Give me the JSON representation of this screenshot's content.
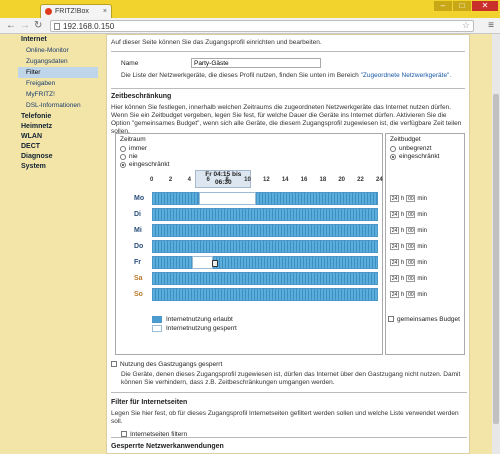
{
  "browser": {
    "tab_title": "FRITZ!Box",
    "url": "192.168.0.150",
    "window_buttons": [
      "–",
      "□",
      "✕"
    ]
  },
  "sidebar": {
    "section": "Internet",
    "sub_items": [
      {
        "label": "Online-Monitor"
      },
      {
        "label": "Zugangsdaten"
      },
      {
        "label": "Filter",
        "active": true
      },
      {
        "label": "Freigaben"
      },
      {
        "label": "MyFRITZ!"
      },
      {
        "label": "DSL-Informationen"
      }
    ],
    "main_items": [
      "Telefonie",
      "Heimnetz",
      "WLAN",
      "DECT",
      "Diagnose",
      "System"
    ]
  },
  "content": {
    "intro": "Auf dieser Seite können Sie das Zugangsprofil einrichten und bearbeiten.",
    "name_label": "Name",
    "name_value": "Party-Gäste",
    "devices_text": "Die Liste der Netzwerkgeräte, die dieses Profil nutzen, finden Sie unten im Bereich",
    "devices_link": "\"Zugeordnete Netzwerkgeräte\".",
    "time_heading": "Zeitbeschränkung",
    "time_text": "Hier können Sie festlegen, innerhalb welchen Zeitraums die zugeordneten Netzwerkgeräte das Internet nutzen dürfen. Wenn Sie ein Zeitbudget vergeben, legen Sie fest, für welche Dauer die Geräte ins Internet dürfen. Aktivieren Sie die Option \"gemeinsames Budget\", wenn sich alle Geräte, die diesem Zugangsprofil zugewiesen ist, die verfügbare Zeit teilen sollen.",
    "zeitraum": {
      "title": "Zeitraum",
      "options": [
        {
          "label": "immer",
          "selected": false
        },
        {
          "label": "nie",
          "selected": false
        },
        {
          "label": "eingeschränkt",
          "selected": true
        }
      ]
    },
    "zeitbudget": {
      "title": "Zeitbudget",
      "options": [
        {
          "label": "unbegrenzt",
          "selected": false
        },
        {
          "label": "eingeschränkt",
          "selected": true
        }
      ],
      "shared_label": "gemeinsames Budget"
    },
    "tooltip": "Fr 04:15 bis 06:30",
    "hours": [
      "0",
      "2",
      "4",
      "6",
      "8",
      "10",
      "12",
      "14",
      "16",
      "18",
      "20",
      "22",
      "24"
    ],
    "days": [
      {
        "label": "Mo",
        "weekend": false,
        "gap": [
          5,
          11
        ]
      },
      {
        "label": "Di",
        "weekend": false,
        "gap": null
      },
      {
        "label": "Mi",
        "weekend": false,
        "gap": null
      },
      {
        "label": "Do",
        "weekend": false,
        "gap": null
      },
      {
        "label": "Fr",
        "weekend": false,
        "gap": [
          4.25,
          6.5
        ]
      },
      {
        "label": "Sa",
        "weekend": true,
        "gap": null
      },
      {
        "label": "So",
        "weekend": true,
        "gap": null
      }
    ],
    "limit": {
      "hours": "24",
      "h_label": "h",
      "minutes": "00",
      "min_label": "min"
    },
    "legend": {
      "allowed": "Internetnutzung erlaubt",
      "blocked": "Internetnutzung gesperrt"
    },
    "guest_label": "Nutzung des Gastzugangs gesperrt",
    "guest_text": "Die Geräte, denen dieses Zugangsprofil zugewiesen ist, dürfen das Internet über den Gastzugang nicht nutzen. Damit können Sie verhindern, dass z.B. Zeitbeschränkungen umgangen werden.",
    "filter_heading": "Filter für Internetseiten",
    "filter_text": "Legen Sie hier fest, ob für dieses Zugangsprofil Internetseiten gefiltert werden sollen und welche Liste verwendet werden soll.",
    "filter_checkbox": "Internetseiten filtern",
    "blocked_apps_heading": "Gesperrte Netzwerkanwendungen"
  },
  "colors": {
    "allowed": "#4a9dd0",
    "blocked": "#ffffff",
    "header": "#f2d22c"
  }
}
